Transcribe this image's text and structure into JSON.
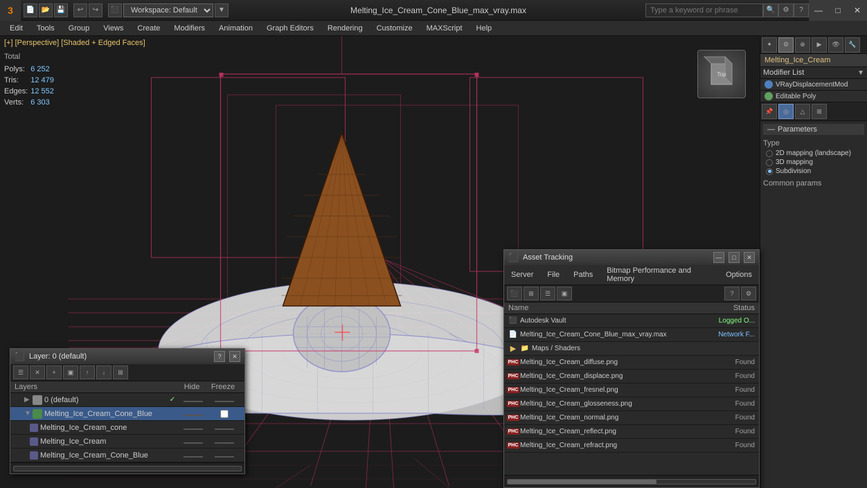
{
  "titlebar": {
    "app_name": "3ds Max",
    "file_title": "Melting_Ice_Cream_Cone_Blue_max_vray.max",
    "search_placeholder": "Type a keyword or phrase",
    "workspace_label": "Workspace: Default",
    "min_btn": "—",
    "max_btn": "□",
    "close_btn": "✕"
  },
  "menu": {
    "items": [
      "Edit",
      "Tools",
      "Group",
      "Views",
      "Create",
      "Modifiers",
      "Animation",
      "Graph Editors",
      "Rendering",
      "Customize",
      "MAXScript",
      "Help"
    ]
  },
  "viewport": {
    "label": "[+] [Perspective] [Shaded + Edged Faces]",
    "stats": {
      "polys_label": "Polys:",
      "polys_val": "6 252",
      "tris_label": "Tris:",
      "tris_val": "12 479",
      "edges_label": "Edges:",
      "edges_val": "12 552",
      "verts_label": "Verts:",
      "verts_val": "6 303",
      "total_label": "Total"
    }
  },
  "right_panel": {
    "object_name": "Melting_Ice_Cream",
    "modifier_list_label": "Modifier List",
    "modifiers": [
      {
        "name": "VRayDisplacementMod"
      },
      {
        "name": "Editable Poly"
      }
    ],
    "parameters_label": "Parameters",
    "type_label": "Type",
    "type_options": [
      {
        "label": "2D mapping (landscape)",
        "selected": false
      },
      {
        "label": "3D mapping",
        "selected": false
      },
      {
        "label": "Subdivision",
        "selected": true
      }
    ],
    "common_params_label": "Common params"
  },
  "layers_panel": {
    "title": "Layer: 0 (default)",
    "close_btn": "✕",
    "question_btn": "?",
    "columns": {
      "name": "Layers",
      "hide": "Hide",
      "freeze": "Freeze"
    },
    "layers": [
      {
        "indent": 0,
        "name": "0 (default)",
        "current": true,
        "selected": false
      },
      {
        "indent": 0,
        "name": "Melting_Ice_Cream_Cone_Blue",
        "current": false,
        "selected": true
      },
      {
        "indent": 1,
        "name": "Melting_Ice_Cream_cone",
        "current": false,
        "selected": false
      },
      {
        "indent": 1,
        "name": "Melting_Ice_Cream",
        "current": false,
        "selected": false
      },
      {
        "indent": 1,
        "name": "Melting_Ice_Cream_Cone_Blue",
        "current": false,
        "selected": false
      }
    ]
  },
  "asset_panel": {
    "title": "Asset Tracking",
    "menu_items": [
      "Server",
      "File",
      "Paths",
      "Bitmap Performance and Memory",
      "Options"
    ],
    "columns": {
      "name": "Name",
      "status": "Status"
    },
    "assets": [
      {
        "type": "vault",
        "name": "Autodesk Vault",
        "status": "Logged O..."
      },
      {
        "type": "file",
        "name": "Melting_Ice_Cream_Cone_Blue_max_vray.max",
        "status": "Network F..."
      },
      {
        "type": "folder",
        "name": "Maps / Shaders",
        "status": ""
      },
      {
        "type": "phc",
        "name": "Melting_Ice_Cream_diffuse.png",
        "status": "Found"
      },
      {
        "type": "phc",
        "name": "Melting_Ice_Cream_displace.png",
        "status": "Found"
      },
      {
        "type": "phc",
        "name": "Melting_Ice_Cream_fresnel.png",
        "status": "Found"
      },
      {
        "type": "phc",
        "name": "Melting_Ice_Cream_glosseness.png",
        "status": "Found"
      },
      {
        "type": "phc",
        "name": "Melting_Ice_Cream_normal.png",
        "status": "Found"
      },
      {
        "type": "phc",
        "name": "Melting_Ice_Cream_reflect.png",
        "status": "Found"
      },
      {
        "type": "phc",
        "name": "Melting_Ice_Cream_refract.png",
        "status": "Found"
      }
    ]
  }
}
